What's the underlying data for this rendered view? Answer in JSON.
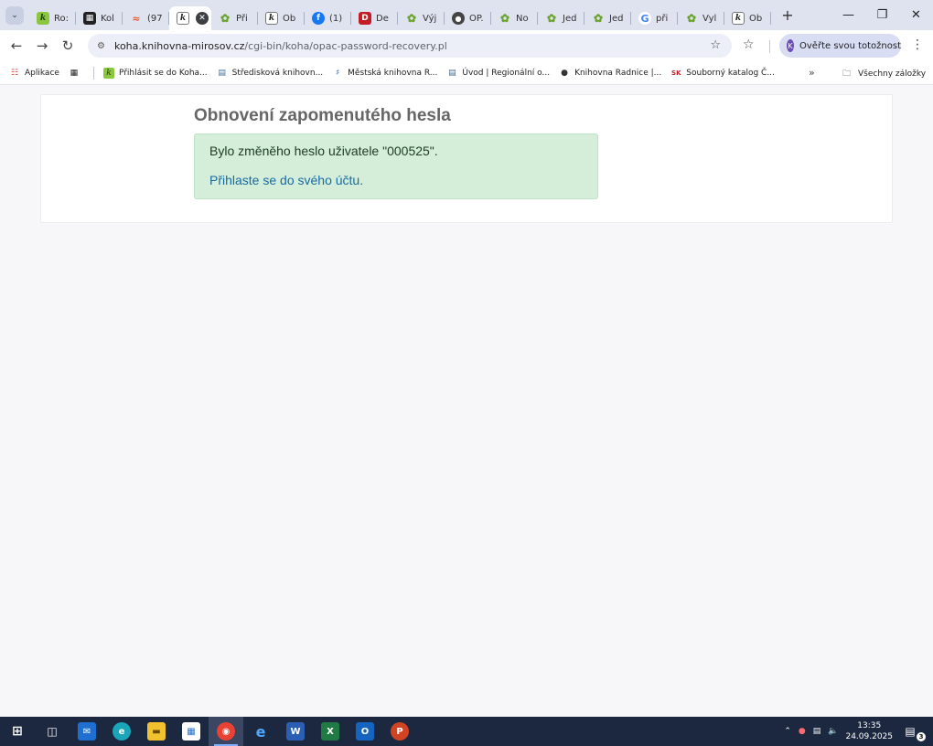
{
  "tabs": [
    {
      "label": "Ro:",
      "icon": "koha-icon"
    },
    {
      "label": "Kol",
      "icon": "grid-icon"
    },
    {
      "label": "(97",
      "icon": "wave-icon"
    },
    {
      "label": "",
      "icon": "koha-white-icon",
      "active": true
    },
    {
      "label": "Při",
      "icon": "leaf-icon"
    },
    {
      "label": "Ob",
      "icon": "koha-white-icon"
    },
    {
      "label": "(1)",
      "icon": "facebook-icon"
    },
    {
      "label": "De",
      "icon": "dv-icon"
    },
    {
      "label": "Výj",
      "icon": "leaf-icon"
    },
    {
      "label": "OP.",
      "icon": "globe-icon"
    },
    {
      "label": "No",
      "icon": "leaf-icon"
    },
    {
      "label": "Jed",
      "icon": "leaf-icon"
    },
    {
      "label": "Jed",
      "icon": "leaf-icon"
    },
    {
      "label": "při",
      "icon": "google-icon"
    },
    {
      "label": "Vyl",
      "icon": "leaf-icon"
    },
    {
      "label": "Ob",
      "icon": "koha-white-icon"
    }
  ],
  "toolbar": {
    "url_host": "koha.knihovna-mirosov.cz",
    "url_path": "/cgi-bin/koha/opac-password-recovery.pl",
    "profile_label": "Ověřte svou totožnost"
  },
  "bookmarks": {
    "apps": "Aplikace",
    "items": [
      "Přihlásit se do Koha...",
      "Středisková knihovn...",
      "Městská knihovna R...",
      "Úvod | Regionální o...",
      "Knihovna Radnice |...",
      "Souborný katalog Č..."
    ],
    "all": "Všechny záložky"
  },
  "page": {
    "title": "Obnovení zapomenutého hesla",
    "message": "Bylo změněho heslo uživatele \"000525\".",
    "login_link": "Přihlaste se do svého účtu."
  },
  "taskbar": {
    "time": "13:35",
    "date": "24.09.2025",
    "notifications": "3"
  },
  "colors": {
    "alert_bg": "#d4eed9",
    "link": "#1a6aa2",
    "taskbar": "#1c2740"
  }
}
